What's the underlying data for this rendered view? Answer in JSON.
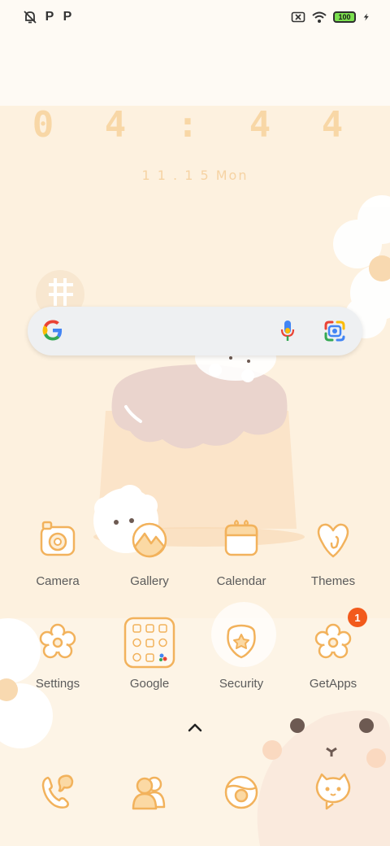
{
  "status_bar": {
    "left_icons": [
      "notifications-off-icon",
      "p-icon",
      "p-icon"
    ],
    "p_glyph": "P",
    "right_icons": [
      "no-sim-icon",
      "wifi-icon",
      "battery-icon",
      "charging-icon"
    ],
    "battery_level": "100"
  },
  "clock": {
    "time": "0 4 : 4 4",
    "date": "1 1 . 1 5  Mon"
  },
  "search_bar": {
    "icons": [
      "google-logo-icon",
      "microphone-icon",
      "google-lens-icon"
    ]
  },
  "apps_row1": [
    {
      "label": "Camera",
      "icon": "camera-icon"
    },
    {
      "label": "Gallery",
      "icon": "gallery-icon"
    },
    {
      "label": "Calendar",
      "icon": "calendar-icon"
    },
    {
      "label": "Themes",
      "icon": "themes-icon"
    }
  ],
  "apps_row2": [
    {
      "label": "Settings",
      "icon": "settings-icon"
    },
    {
      "label": "Google",
      "icon": "google-folder-icon"
    },
    {
      "label": "Security",
      "icon": "security-icon"
    },
    {
      "label": "GetApps",
      "icon": "getapps-icon",
      "badge": "1"
    }
  ],
  "dock": [
    {
      "icon": "phone-icon"
    },
    {
      "icon": "contacts-icon"
    },
    {
      "icon": "browser-icon"
    },
    {
      "icon": "messages-icon"
    }
  ],
  "colors": {
    "icon_stroke": "#f2b25c",
    "icon_fill": "#fdeed6",
    "badge": "#f25a1c",
    "label": "#5b5b5b"
  }
}
